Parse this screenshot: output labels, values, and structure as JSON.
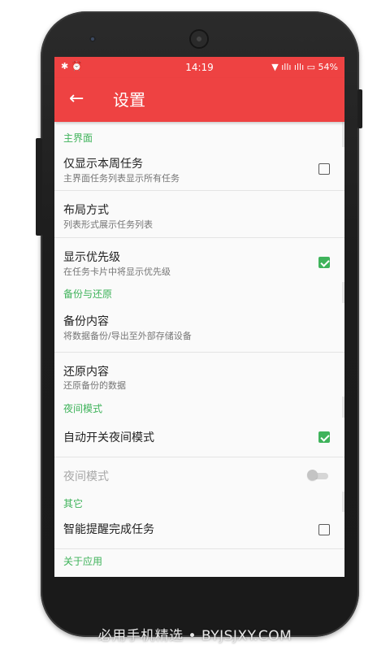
{
  "status_bar": {
    "left_icons": "✱ ⏰",
    "time": "14:19",
    "right_icons": "▼ ıllı ıllı ▭",
    "battery": "54%"
  },
  "toolbar": {
    "back_icon": "←",
    "title": "设置"
  },
  "sections": {
    "main_ui": "主界面",
    "backup": "备份与还原",
    "night": "夜间模式",
    "other": "其它",
    "about": "关于应用"
  },
  "items": {
    "show_week": {
      "title": "仅显示本周任务",
      "subtitle": "主界面任务列表显示所有任务",
      "checked": false
    },
    "layout": {
      "title": "布局方式",
      "subtitle": "列表形式展示任务列表"
    },
    "priority": {
      "title": "显示优先级",
      "subtitle": "在任务卡片中将显示优先级",
      "checked": true
    },
    "backup_content": {
      "title": "备份内容",
      "subtitle": "将数据备份/导出至外部存储设备"
    },
    "restore_content": {
      "title": "还原内容",
      "subtitle": "还原备份的数据"
    },
    "auto_night": {
      "title": "自动开关夜间模式",
      "checked": true
    },
    "night_mode": {
      "title": "夜间模式",
      "enabled": false,
      "on": false
    },
    "smart_remind": {
      "title": "智能提醒完成任务",
      "checked": false
    }
  },
  "watermark": "必用手机精选 • BYJSJXY.COM",
  "colors": {
    "accent_red": "#ee4242",
    "accent_green": "#3fb35b"
  }
}
